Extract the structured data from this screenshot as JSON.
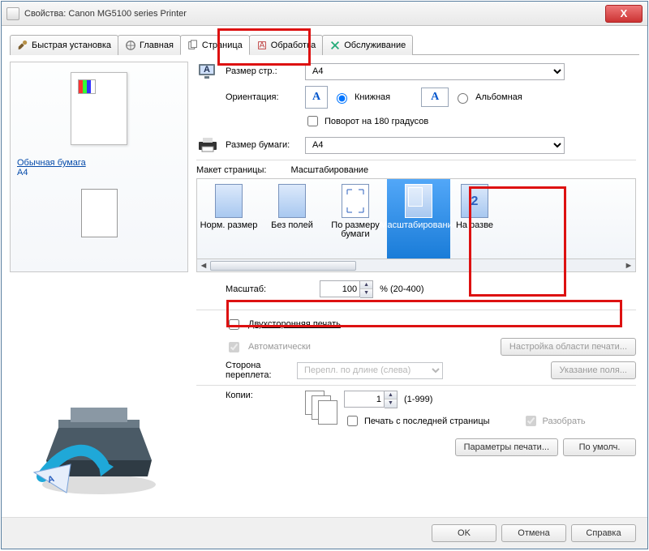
{
  "window": {
    "title": "Свойства: Canon MG5100 series Printer",
    "close_glyph": "X"
  },
  "tabs": [
    {
      "label": "Быстрая установка"
    },
    {
      "label": "Главная"
    },
    {
      "label": "Страница"
    },
    {
      "label": "Обработка"
    },
    {
      "label": "Обслуживание"
    }
  ],
  "preview": {
    "paper_type": "Обычная бумага",
    "paper_size": "A4"
  },
  "page_size": {
    "label": "Размер стр.:",
    "value": "A4"
  },
  "orientation": {
    "label": "Ориентация:",
    "portrait": "Книжная",
    "landscape": "Альбомная",
    "rotate180": "Поворот на 180 градусов"
  },
  "paper_size": {
    "label": "Размер бумаги:",
    "value": "A4"
  },
  "layout": {
    "section_label": "Макет страницы:",
    "selected_name": "Масштабирование",
    "items": [
      "Норм. размер",
      "Без полей",
      "По размеру бумаги",
      "Масштабирование",
      "На разве"
    ]
  },
  "scale": {
    "label": "Масштаб:",
    "value": "100",
    "range": "% (20-400)"
  },
  "duplex": {
    "label": "Двухсторонняя печать",
    "auto": "Автоматически",
    "area_btn": "Настройка области печати...",
    "side_label": "Сторона переплета:",
    "side_value": "Перепл. по длине (слева)",
    "margin_btn": "Указание поля..."
  },
  "copies": {
    "label": "Копии:",
    "value": "1",
    "range": "(1-999)",
    "from_last": "Печать с последней страницы",
    "collate": "Разобрать"
  },
  "buttons": {
    "print_params": "Параметры печати...",
    "defaults": "По умолч.",
    "ok": "OK",
    "cancel": "Отмена",
    "help": "Справка"
  }
}
